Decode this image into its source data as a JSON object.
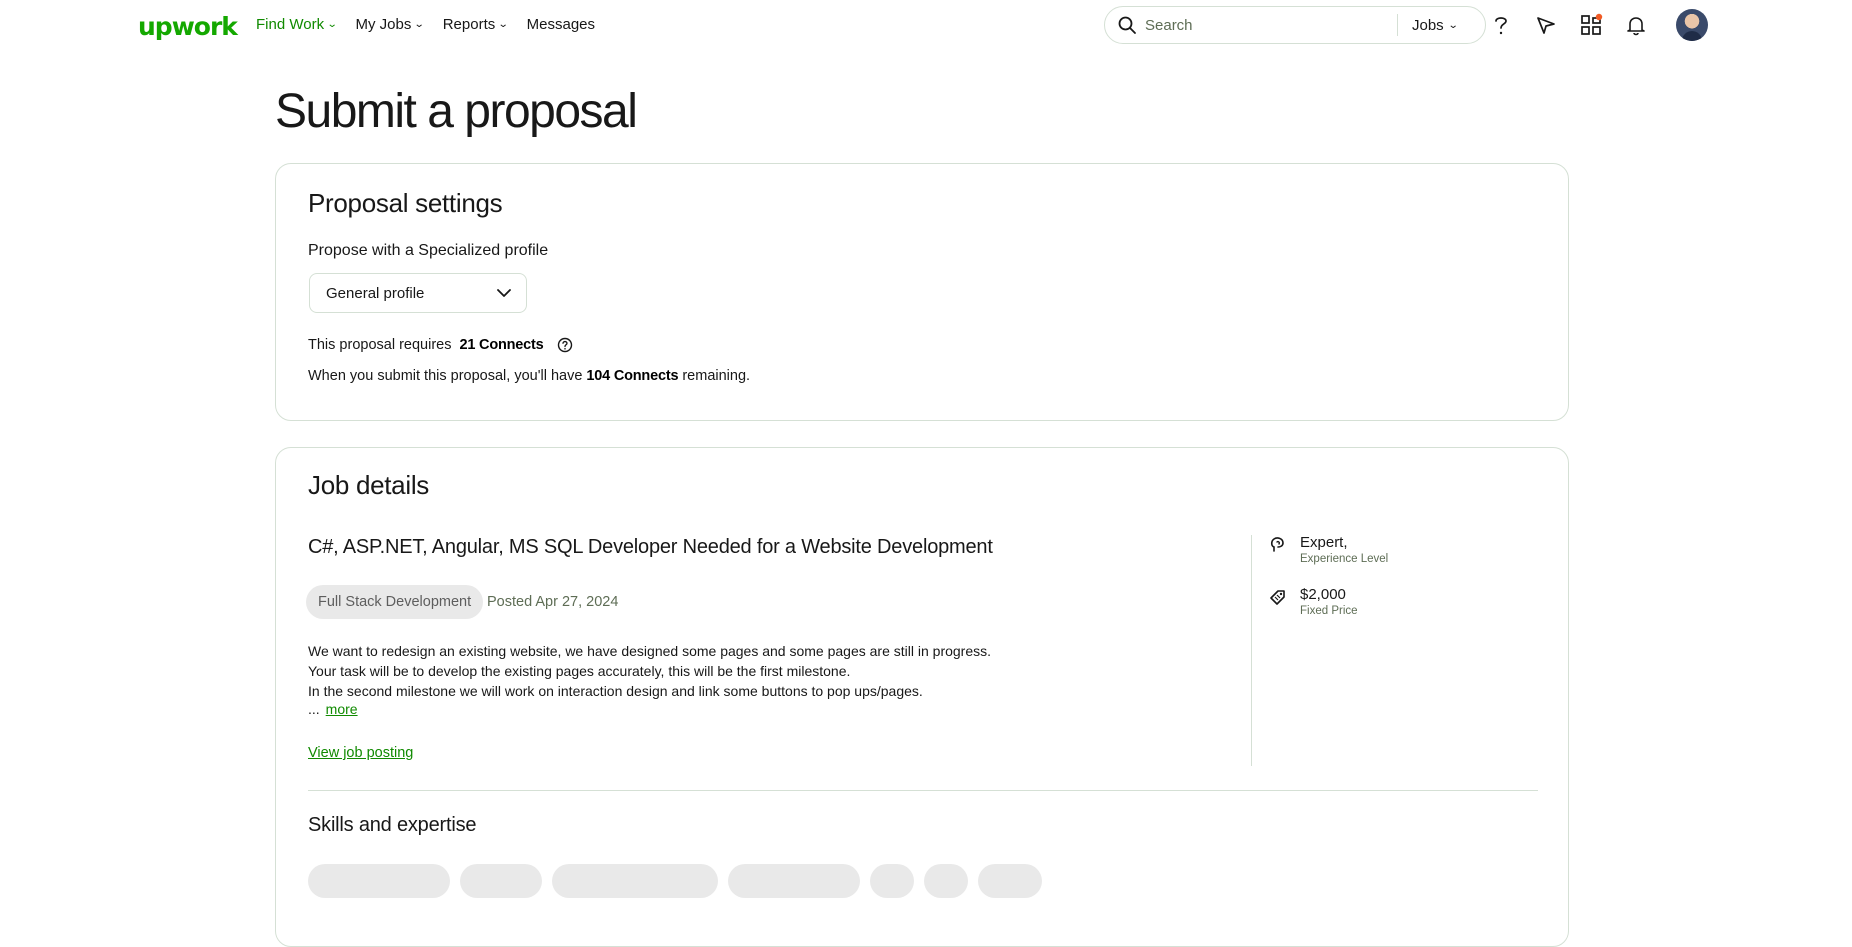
{
  "nav": {
    "logo": "upwork",
    "links": [
      {
        "label": "Find Work",
        "has_caret": true
      },
      {
        "label": "My Jobs",
        "has_caret": true
      },
      {
        "label": "Reports",
        "has_caret": true
      },
      {
        "label": "Messages",
        "has_caret": false
      }
    ],
    "search_placeholder": "Search",
    "search_scope": "Jobs",
    "icons": [
      "help-icon",
      "direct-contracts-icon",
      "apps-grid-icon",
      "notifications-bell-icon",
      "user-avatar"
    ],
    "accent_color": "#14a800",
    "badge_color": "#f15a24"
  },
  "page": {
    "title": "Submit a proposal"
  },
  "settings": {
    "title": "Proposal settings",
    "profile_label": "Propose with a Specialized profile",
    "profile_value": "General profile",
    "connects_prefix": "This proposal requires ",
    "connects_required": "21 Connects",
    "remaining_prefix": "When you submit this proposal, you'll have ",
    "remaining_value": "104 Connects",
    "remaining_suffix": " remaining."
  },
  "job": {
    "section_title": "Job details",
    "title": "C#, ASP.NET, Angular, MS SQL Developer Needed for a Website Development",
    "category": "Full Stack Development",
    "posted": "Posted Apr 27, 2024",
    "description_lines": [
      "We want to redesign an existing website, we have designed some pages and some pages are still in progress.",
      "Your task will be to develop the existing pages accurately, this will be the first milestone.",
      "In the second milestone we will work on interaction design and link some buttons to pop ups/pages."
    ],
    "ellipsis": "...",
    "more_label": "more",
    "view_posting_label": "View job posting",
    "experience_value": "Expert,",
    "experience_label": "Experience Level",
    "price_value": "$2,000",
    "price_label": "Fixed Price"
  },
  "skills": {
    "title": "Skills and expertise"
  }
}
